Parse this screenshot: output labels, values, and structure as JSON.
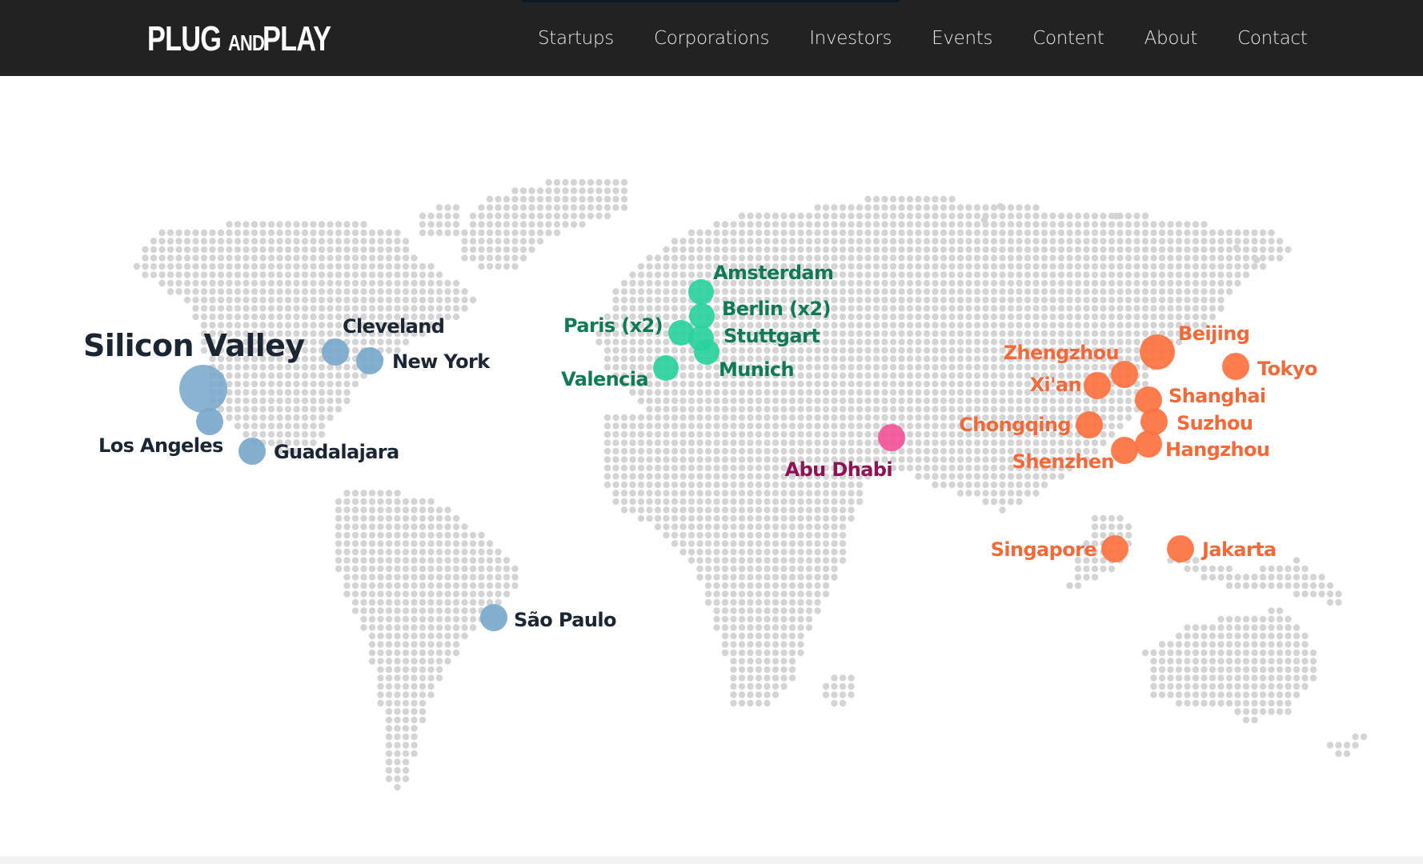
{
  "header": {
    "logo": {
      "part1": "PLUG",
      "part2": "AND",
      "part3": "PLAY"
    },
    "nav": [
      "Startups",
      "Corporations",
      "Investors",
      "Events",
      "Content",
      "About",
      "Contact"
    ]
  },
  "colors": {
    "header_bg": "#222222",
    "dots": "#d4d4d6",
    "americas": "#7aa8cb",
    "americas_text": "#1b2632",
    "europe": "#2bd19c",
    "europe_text": "#0f7a55",
    "middle_east": "#f45399",
    "middle_east_text": "#8a1455",
    "asia": "#fd7240",
    "asia_text": "#f26a3a"
  },
  "map": {
    "locations": [
      {
        "name": "Silicon Valley",
        "region": "americas"
      },
      {
        "name": "Los Angeles",
        "region": "americas"
      },
      {
        "name": "Guadalajara",
        "region": "americas"
      },
      {
        "name": "Cleveland",
        "region": "americas"
      },
      {
        "name": "New York",
        "region": "americas"
      },
      {
        "name": "São Paulo",
        "region": "americas"
      },
      {
        "name": "Amsterdam",
        "region": "europe"
      },
      {
        "name": "Berlin (x2)",
        "region": "europe"
      },
      {
        "name": "Paris (x2)",
        "region": "europe"
      },
      {
        "name": "Stuttgart",
        "region": "europe"
      },
      {
        "name": "Munich",
        "region": "europe"
      },
      {
        "name": "Valencia",
        "region": "europe"
      },
      {
        "name": "Abu Dhabi",
        "region": "middle_east"
      },
      {
        "name": "Beijing",
        "region": "asia"
      },
      {
        "name": "Zhengzhou",
        "region": "asia"
      },
      {
        "name": "Xi'an",
        "region": "asia"
      },
      {
        "name": "Tokyo",
        "region": "asia"
      },
      {
        "name": "Shanghai",
        "region": "asia"
      },
      {
        "name": "Chongqing",
        "region": "asia"
      },
      {
        "name": "Suzhou",
        "region": "asia"
      },
      {
        "name": "Hangzhou",
        "region": "asia"
      },
      {
        "name": "Shenzhen",
        "region": "asia"
      },
      {
        "name": "Singapore",
        "region": "asia"
      },
      {
        "name": "Jakarta",
        "region": "asia"
      }
    ]
  }
}
